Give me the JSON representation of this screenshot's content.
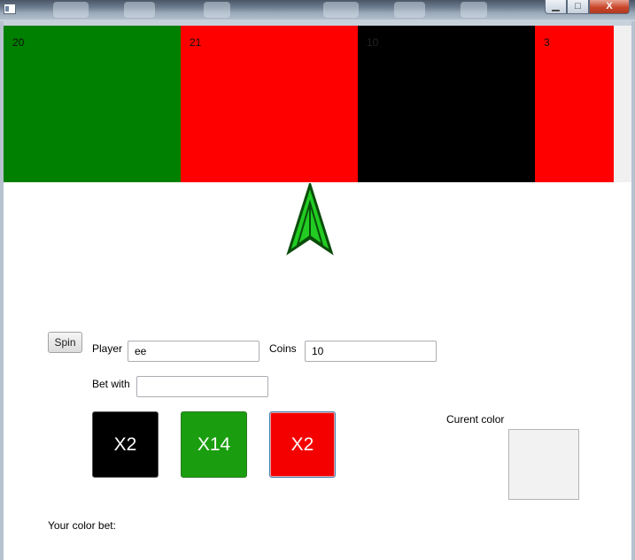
{
  "window": {
    "controls": {
      "minimize": "▁",
      "maximize": "□",
      "close": "X"
    }
  },
  "wheel": {
    "tiles": [
      {
        "number": "20",
        "color": "#008000"
      },
      {
        "number": "21",
        "color": "#ff0000"
      },
      {
        "number": "10",
        "color": "#000000"
      },
      {
        "number": "3",
        "color": "#ff0000"
      }
    ]
  },
  "pointer": {
    "icon": "arrow-up-icon",
    "color": "#22cc22"
  },
  "controls": {
    "spin_label": "Spin",
    "player_label": "Player",
    "player_value": "ee",
    "coins_label": "Coins",
    "coins_value": "10",
    "bet_label": "Bet with",
    "bet_value": ""
  },
  "bet_buttons": [
    {
      "label": "X2",
      "color": "#000000"
    },
    {
      "label": "X14",
      "color": "#1a9e0f"
    },
    {
      "label": "X2",
      "color": "#f40000"
    }
  ],
  "current_color": {
    "label": "Curent color",
    "value": "#f2f2f2"
  },
  "your_bet": {
    "label": "Your color bet:"
  }
}
